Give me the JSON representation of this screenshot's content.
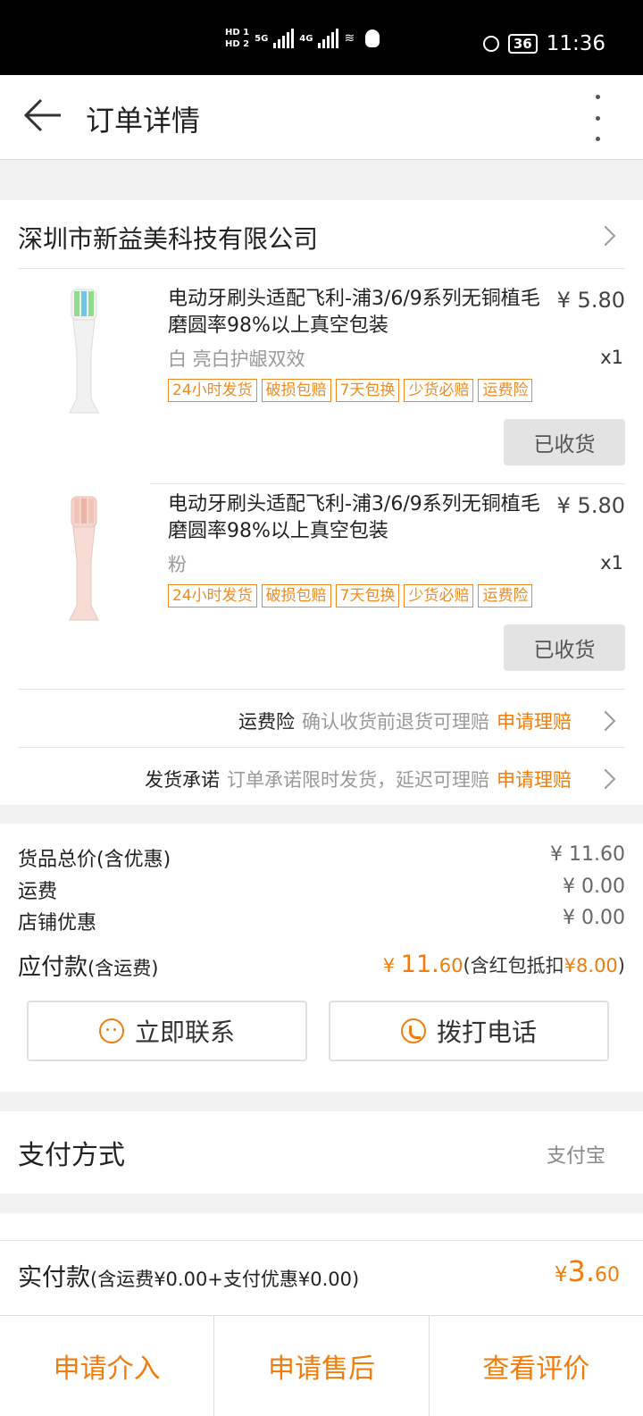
{
  "status_bar": {
    "hd1": "HD 1",
    "hd2": "HD 2",
    "net1": "5G",
    "net2": "4G",
    "carrier_icon": "carrier-logo",
    "battery": "36",
    "time": "11:36"
  },
  "header": {
    "title": "订单详情"
  },
  "shop": {
    "name": "深圳市新益美科技有限公司"
  },
  "items": [
    {
      "name": "电动牙刷头适配飞利-浦3/6/9系列无铜植毛磨圆率98%以上真空包装",
      "price": "¥ 5.80",
      "sku": "白 亮白护龈双效",
      "qty": "x1",
      "tags": [
        "24小时发货",
        "破损包赔",
        "7天包换",
        "少货必赔",
        "运费险"
      ],
      "status": "已收货",
      "color": "#f4f4f4"
    },
    {
      "name": "电动牙刷头适配飞利-浦3/6/9系列无铜植毛磨圆率98%以上真空包装",
      "price": "¥ 5.80",
      "sku": "粉",
      "qty": "x1",
      "tags": [
        "24小时发货",
        "破损包赔",
        "7天包换",
        "少货必赔",
        "运费险"
      ],
      "status": "已收货",
      "color": "#f5d3cb"
    }
  ],
  "services": [
    {
      "key": "运费险",
      "desc": "确认收货前退货可理赔",
      "action": "申请理赔"
    },
    {
      "key": "发货承诺",
      "desc": "订单承诺限时发货，延迟可理赔",
      "action": "申请理赔"
    }
  ],
  "pricing": [
    {
      "label": "货品总价(含优惠)",
      "value": "¥ 11.60"
    },
    {
      "label": "运费",
      "value": "¥ 0.00"
    },
    {
      "label": "店铺优惠",
      "value": "¥ 0.00"
    }
  ],
  "payable": {
    "label": "应付款",
    "label_note": "(含运费)",
    "symbol": "¥ ",
    "int": "11.",
    "dec": "60",
    "note_pre": "(含红包抵扣",
    "note_amt": "¥8.00",
    "note_post": ")"
  },
  "contact": {
    "chat": "立即联系",
    "call": "拨打电话"
  },
  "payment": {
    "label": "支付方式",
    "value": "支付宝"
  },
  "actual": {
    "label": "实付款",
    "note": "(含运费¥0.00+支付优惠¥0.00)",
    "symbol": "¥",
    "int": "3.",
    "dec": "60"
  },
  "bottom": {
    "b1": "申请介入",
    "b2": "申请售后",
    "b3": "查看评价"
  },
  "colors": {
    "accent": "#f07c0c",
    "tag": "#f08a1e"
  }
}
